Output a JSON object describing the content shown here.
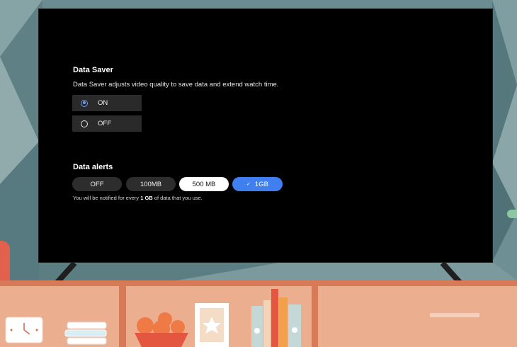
{
  "data_saver": {
    "title": "Data Saver",
    "description": "Data Saver adjusts video quality to save data and extend watch time.",
    "options": [
      {
        "label": "ON",
        "selected": true
      },
      {
        "label": "OFF",
        "selected": false
      }
    ]
  },
  "data_alerts": {
    "title": "Data alerts",
    "options": [
      {
        "label": "OFF",
        "style": "dark"
      },
      {
        "label": "100MB",
        "style": "dark"
      },
      {
        "label": "500 MB",
        "style": "white"
      },
      {
        "label": "1GB",
        "style": "blue",
        "selected": true,
        "check": "✓"
      }
    ],
    "note_prefix": "You will be notified for every ",
    "note_value": "1 GB",
    "note_suffix": " of data that you use."
  },
  "colors": {
    "accent": "#3f7ff0",
    "radio_selected": "#6e9bf0",
    "screen": "#000000",
    "shelf": "#d77a58"
  }
}
